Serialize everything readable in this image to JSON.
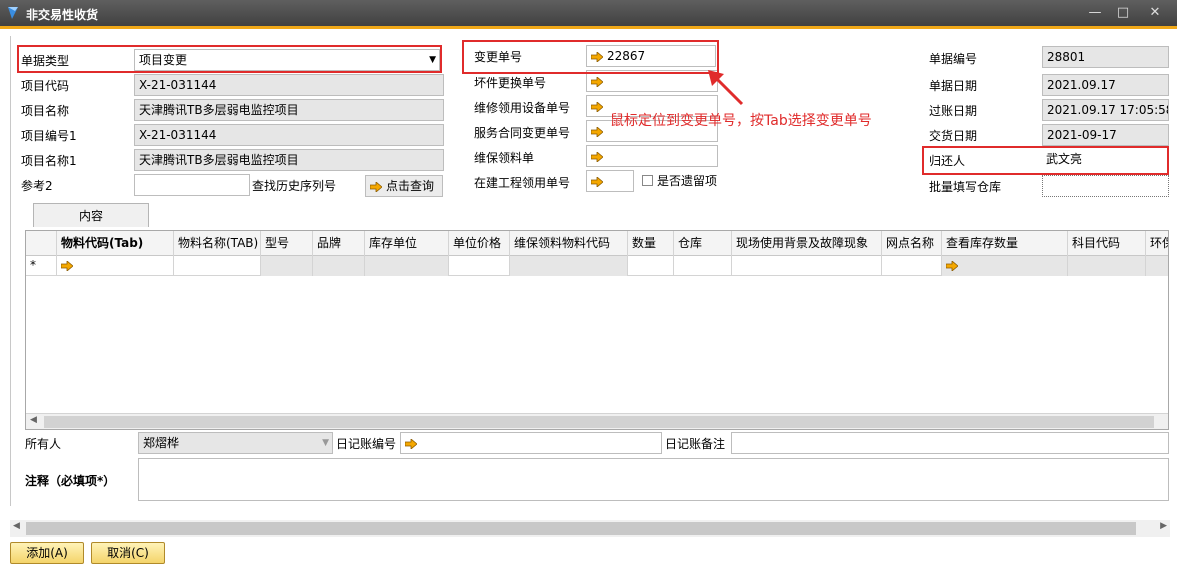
{
  "window": {
    "title": "非交易性收货"
  },
  "left_fields": [
    {
      "label": "单据类型",
      "value": "项目变更"
    },
    {
      "label": "项目代码",
      "value": "X-21-031144"
    },
    {
      "label": "项目名称",
      "value": "天津腾讯TB多层弱电监控项目"
    },
    {
      "label": "项目编号1",
      "value": "X-21-031144"
    },
    {
      "label": "项目名称1",
      "value": "天津腾讯TB多层弱电监控项目"
    },
    {
      "label": "参考2",
      "value": ""
    }
  ],
  "history_label": "查找历史序列号",
  "query_button": "点击查询",
  "middle_fields": [
    {
      "label": "变更单号",
      "value": "22867"
    },
    {
      "label": "坏件更换单号",
      "value": ""
    },
    {
      "label": "维修领用设备单号",
      "value": ""
    },
    {
      "label": "服务合同变更单号",
      "value": ""
    },
    {
      "label": "维保领料单",
      "value": ""
    },
    {
      "label": "在建工程领用单号",
      "value": ""
    }
  ],
  "leftover_label": "是否遗留项",
  "annotation": "鼠标定位到变更单号，按Tab选择变更单号",
  "right_fields": [
    {
      "label": "单据编号",
      "value": "28801"
    },
    {
      "label": "单据日期",
      "value": "2021.09.17"
    },
    {
      "label": "过账日期",
      "value": "2021.09.17  17:05:58"
    },
    {
      "label": "交货日期",
      "value": "2021-09-17"
    },
    {
      "label": "归还人",
      "value": "武文亮"
    },
    {
      "label": "批量填写仓库",
      "value": ""
    }
  ],
  "tab_label": "内容",
  "grid": {
    "columns": [
      "物料代码(Tab)",
      "物料名称(TAB)",
      "型号",
      "品牌",
      "库存单位",
      "单位价格",
      "维保领料物料代码",
      "数量",
      "仓库",
      "现场使用背景及故障现象",
      "网点名称",
      "查看库存数量",
      "科目代码",
      "环保"
    ],
    "new_row_marker": "*"
  },
  "footer": {
    "owner_label": "所有人",
    "owner_value": "郑熠桦",
    "journal_label": "日记账编号",
    "journal_note_label": "日记账备注",
    "remark_label": "注释（必填项*）"
  },
  "buttons": {
    "add": "添加(A)",
    "cancel": "取消(C)"
  },
  "colors": {
    "accent": "#f0a818",
    "annotation": "#e02b2b",
    "arrow": "#f5a800"
  }
}
